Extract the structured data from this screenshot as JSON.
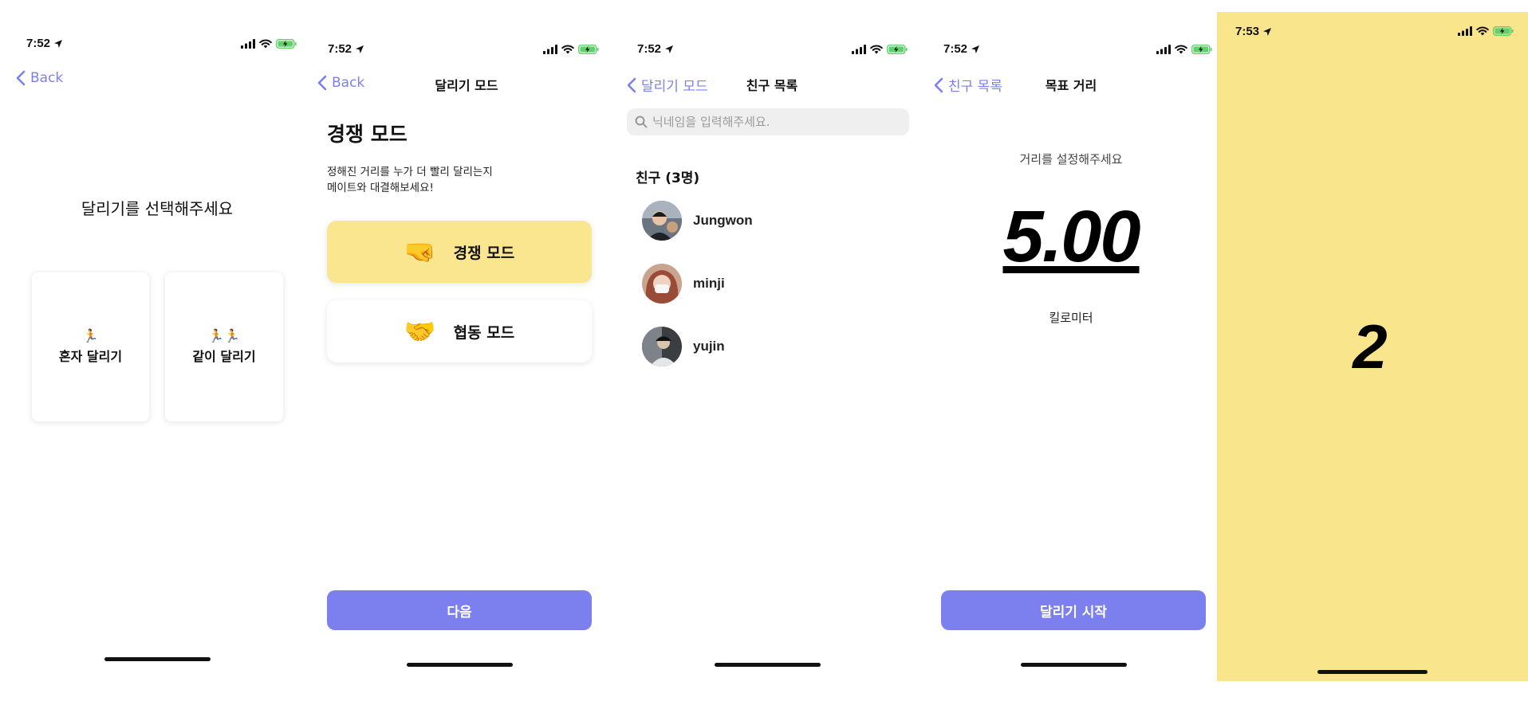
{
  "status_bar": {
    "time_first": "7:52",
    "time_last": "7:53"
  },
  "screen1": {
    "back_label": "Back",
    "heading": "달리기를 선택해주세요",
    "cards": [
      {
        "emoji": "🏃",
        "label": "혼자 달리기"
      },
      {
        "emoji": "🏃🏃",
        "label": "같이 달리기"
      }
    ]
  },
  "screen2": {
    "back_label": "Back",
    "nav_title": "달리기 모드",
    "title": "경쟁 모드",
    "description_line1": "정해진 거리를 누가 더 빨리 달리는지",
    "description_line2": "메이트와 대결해보세요!",
    "modes": [
      {
        "emoji": "🤜",
        "label": "경쟁 모드",
        "selected": true
      },
      {
        "emoji": "🤝",
        "label": "협동 모드",
        "selected": false
      }
    ],
    "next_label": "다음"
  },
  "screen3": {
    "back_label": "달리기 모드",
    "nav_title": "친구 목록",
    "search_placeholder": "닉네임을 입력해주세요.",
    "section_title": "친구 (3명)",
    "friends": [
      {
        "name": "Jungwon"
      },
      {
        "name": "minji"
      },
      {
        "name": "yujin"
      }
    ]
  },
  "screen4": {
    "back_label": "친구 목록",
    "nav_title": "목표 거리",
    "prompt": "거리를 설정해주세요",
    "distance": "5.00",
    "unit": "킬로미터",
    "start_label": "달리기 시작"
  },
  "screen5": {
    "countdown": "2"
  },
  "colors": {
    "accent": "#7c80ee",
    "highlight_yellow": "#f9e68e",
    "countdown_background": "#f9e68c",
    "battery_green": "#5cd16c"
  }
}
